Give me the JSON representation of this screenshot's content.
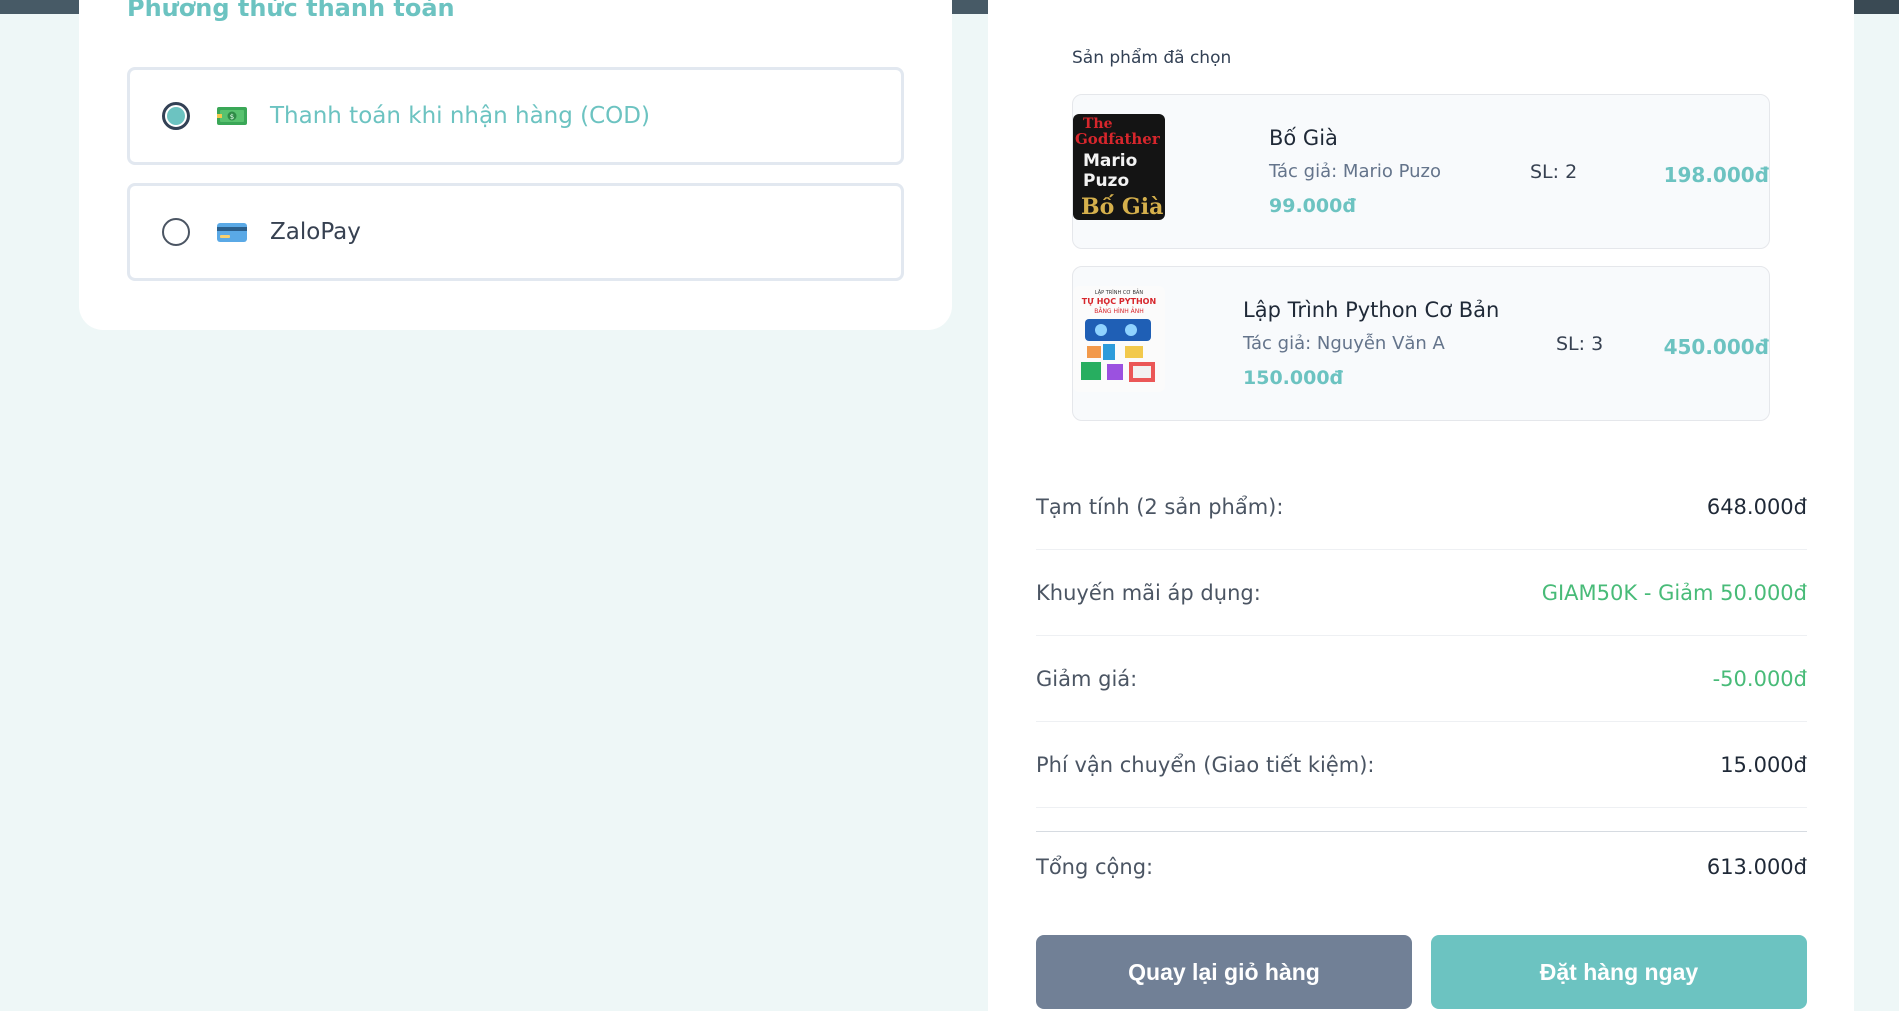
{
  "payment": {
    "title": "Phương thức thanh toán",
    "options": [
      {
        "label": "Thanh toán khi nhận hàng (COD)",
        "icon": "cash-icon",
        "selected": true
      },
      {
        "label": "ZaloPay",
        "icon": "credit-card-icon",
        "selected": false
      }
    ]
  },
  "order": {
    "products_title": "Sản phẩm đã chọn",
    "products": [
      {
        "name": "Bố Già",
        "author": "Tác giả: Mario Puzo",
        "price": "99.000đ",
        "qty": "SL: 2",
        "total": "198.000đ",
        "cover_lines": [
          "The",
          "Godfather",
          "Mario",
          "Puzo",
          "Bố Già"
        ]
      },
      {
        "name": "Lập Trình Python Cơ Bản",
        "author": "Tác giả: Nguyễn Văn A",
        "price": "150.000đ",
        "qty": "SL: 3",
        "total": "450.000đ",
        "cover_lines": [
          "LẬP TRÌNH CƠ BẢN",
          "TỰ HỌC PYTHON",
          "BẰNG HÌNH ẢNH"
        ]
      }
    ],
    "summary": {
      "subtotal_label": "Tạm tính (2 sản phẩm):",
      "subtotal_value": "648.000đ",
      "promo_label": "Khuyến mãi áp dụng:",
      "promo_value": "GIAM50K - Giảm 50.000đ",
      "discount_label": "Giảm giá:",
      "discount_value": "-50.000đ",
      "shipping_label": "Phí vận chuyển (Giao tiết kiệm):",
      "shipping_value": "15.000đ",
      "total_label": "Tổng cộng:",
      "total_value": "613.000đ"
    },
    "buttons": {
      "back": "Quay lại giỏ hàng",
      "place_order": "Đặt hàng ngay"
    }
  },
  "colors": {
    "accent": "#6cc3c1",
    "green": "#48bb78",
    "back_button": "#718096",
    "background": "#eef7f7"
  }
}
